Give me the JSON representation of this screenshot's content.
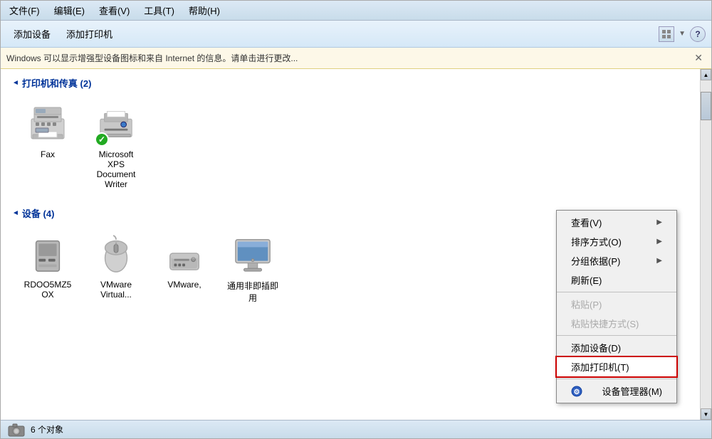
{
  "menubar": {
    "items": [
      {
        "label": "文件(F)"
      },
      {
        "label": "编辑(E)"
      },
      {
        "label": "查看(V)"
      },
      {
        "label": "工具(T)"
      },
      {
        "label": "帮助(H)"
      }
    ]
  },
  "toolbar": {
    "add_device_label": "添加设备",
    "add_printer_label": "添加打印机"
  },
  "infobar": {
    "message": "Windows 可以显示增强型设备图标和来自 Internet 的信息。请单击进行更改..."
  },
  "printers_section": {
    "title": "打印机和传真 (2)",
    "devices": [
      {
        "name": "Fax",
        "type": "fax"
      },
      {
        "name": "Microsoft XPS Document Writer",
        "type": "xps"
      }
    ]
  },
  "devices_section": {
    "title": "设备 (4)",
    "devices": [
      {
        "name": "RDOO5MZ5OX",
        "type": "drive"
      },
      {
        "name": "VMware Virtual...",
        "type": "mouse"
      },
      {
        "name": "VMware,",
        "type": "mac"
      },
      {
        "name": "通用非即插即用",
        "type": "monitor"
      }
    ]
  },
  "statusbar": {
    "count_text": "6 个对象",
    "icon_type": "camera"
  },
  "context_menu": {
    "items": [
      {
        "label": "查看(V)",
        "has_arrow": true,
        "disabled": false,
        "highlighted": false,
        "id": "view"
      },
      {
        "label": "排序方式(O)",
        "has_arrow": true,
        "disabled": false,
        "highlighted": false,
        "id": "sort"
      },
      {
        "label": "分组依据(P)",
        "has_arrow": true,
        "disabled": false,
        "highlighted": false,
        "id": "group"
      },
      {
        "label": "刷新(E)",
        "has_arrow": false,
        "disabled": false,
        "highlighted": false,
        "id": "refresh"
      },
      {
        "separator": true
      },
      {
        "label": "粘贴(P)",
        "has_arrow": false,
        "disabled": true,
        "highlighted": false,
        "id": "paste"
      },
      {
        "label": "粘贴快捷方式(S)",
        "has_arrow": false,
        "disabled": true,
        "highlighted": false,
        "id": "paste-shortcut"
      },
      {
        "separator": true
      },
      {
        "label": "添加设备(D)",
        "has_arrow": false,
        "disabled": false,
        "highlighted": false,
        "id": "add-device"
      },
      {
        "label": "添加打印机(T)",
        "has_arrow": false,
        "disabled": false,
        "highlighted": true,
        "id": "add-printer"
      },
      {
        "separator": true
      },
      {
        "label": "设备管理器(M)",
        "has_arrow": false,
        "disabled": false,
        "highlighted": false,
        "id": "device-manager",
        "has_icon": true
      }
    ]
  }
}
